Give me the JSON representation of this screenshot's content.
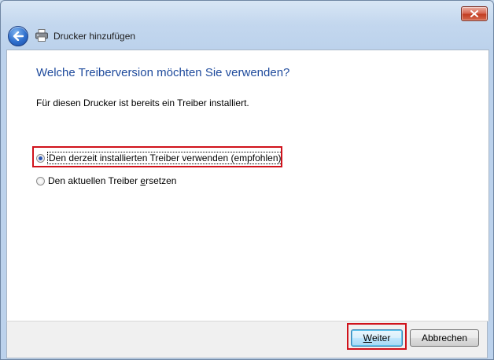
{
  "window": {
    "title": "Drucker hinzufügen"
  },
  "page": {
    "heading": "Welche Treiberversion möchten Sie verwenden?",
    "description": "Für diesen Drucker ist bereits ein Treiber installiert."
  },
  "options": [
    {
      "label": "Den derzeit installierten Treiber verwenden (empfohlen)",
      "selected": true
    },
    {
      "label_pre": "Den aktuellen Treiber ",
      "label_accel": "e",
      "label_post": "rsetzen",
      "selected": false
    }
  ],
  "buttons": {
    "next_accel": "W",
    "next_rest": "eiter",
    "cancel": "Abbrechen"
  },
  "colors": {
    "heading": "#1e4a9c",
    "highlight": "#d0121b",
    "radio_selected": "#2a56b5"
  },
  "icons": {
    "close": "close-icon",
    "back": "back-arrow-icon",
    "printer": "printer-icon"
  }
}
